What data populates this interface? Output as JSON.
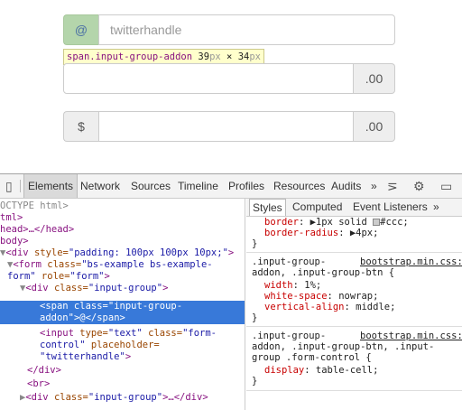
{
  "preview": {
    "group1": {
      "addon": "@",
      "placeholder": "twitterhandle"
    },
    "group2": {
      "suffix": ".00"
    },
    "group3": {
      "prefix": "$",
      "suffix": ".00"
    },
    "tooltip": {
      "tag": "span.input-group-addon",
      "w": "39",
      "x": " × ",
      "h": "34",
      "unit": "px"
    }
  },
  "devtools": {
    "tabs": [
      "Elements",
      "Network",
      "Sources",
      "Timeline",
      "Profiles",
      "Resources",
      "Audits"
    ],
    "more": "»",
    "sidebar_tabs": [
      "Styles",
      "Computed",
      "Event Listeners"
    ],
    "dom": [
      {
        "t": "OCTYPE html>"
      },
      {
        "t": "tml>"
      },
      {
        "t": "head>…</head>"
      },
      {
        "t": "body>"
      },
      {
        "arrow": "▼",
        "tag": "<div",
        "attr": " style=",
        "val": "\"padding: 100px 100px 10px;\"",
        "end": ">"
      },
      {
        "arrow": "▼",
        "tag": "<form",
        "attr": " class=",
        "val": "\"bs-example bs-example-",
        "end": ""
      },
      {
        "cont": "form\"",
        "attr": " role=",
        "val": "\"form\"",
        "end": ">"
      },
      {
        "arrow": "▼",
        "tag": "<div",
        "attr": " class=",
        "val": "\"input-group\"",
        "end": ">"
      },
      {
        "tag": "<span",
        "attr": " class=",
        "val": "\"input-group-",
        "end": ""
      },
      {
        "cont": "addon\"",
        "end": ">@</span>"
      },
      {
        "tag": "<input",
        "attr": " type=",
        "val": "\"text\"",
        "attr2": " class=",
        "val2": "\"form-",
        "end": ""
      },
      {
        "cont": "control\"",
        "attr": " placeholder=",
        "end": ""
      },
      {
        "val": "\"twitterhandle\"",
        "end": ">"
      },
      {
        "tag": "</div>"
      },
      {
        "tag": "<br>"
      },
      {
        "arrow": "▶",
        "tag": "<div",
        "attr": " class=",
        "val": "\"input-group\"",
        "end": ">…</div>"
      }
    ],
    "styles": {
      "r1a": "border",
      "r1b": ": ▶1px solid ",
      "r1c": "#ccc;",
      "r2a": "border-radius",
      "r2b": ": ▶4px;",
      "close": "}",
      "sel1a": ".input-group-",
      "src1": "bootstrap.min.css:",
      "sel1b": "addon, .input-group-btn {",
      "p1": "width",
      "v1": ": 1%;",
      "p2": "white-space",
      "v2": ": nowrap;",
      "p3": "vertical-align",
      "v3": ": middle;",
      "sel2a": ".input-group-",
      "src2": "bootstrap.min.css:",
      "sel2b": "addon, .input-group-btn, .input-",
      "sel2c": "group .form-control {",
      "p4": "display",
      "v4": ": table-cell;"
    }
  }
}
